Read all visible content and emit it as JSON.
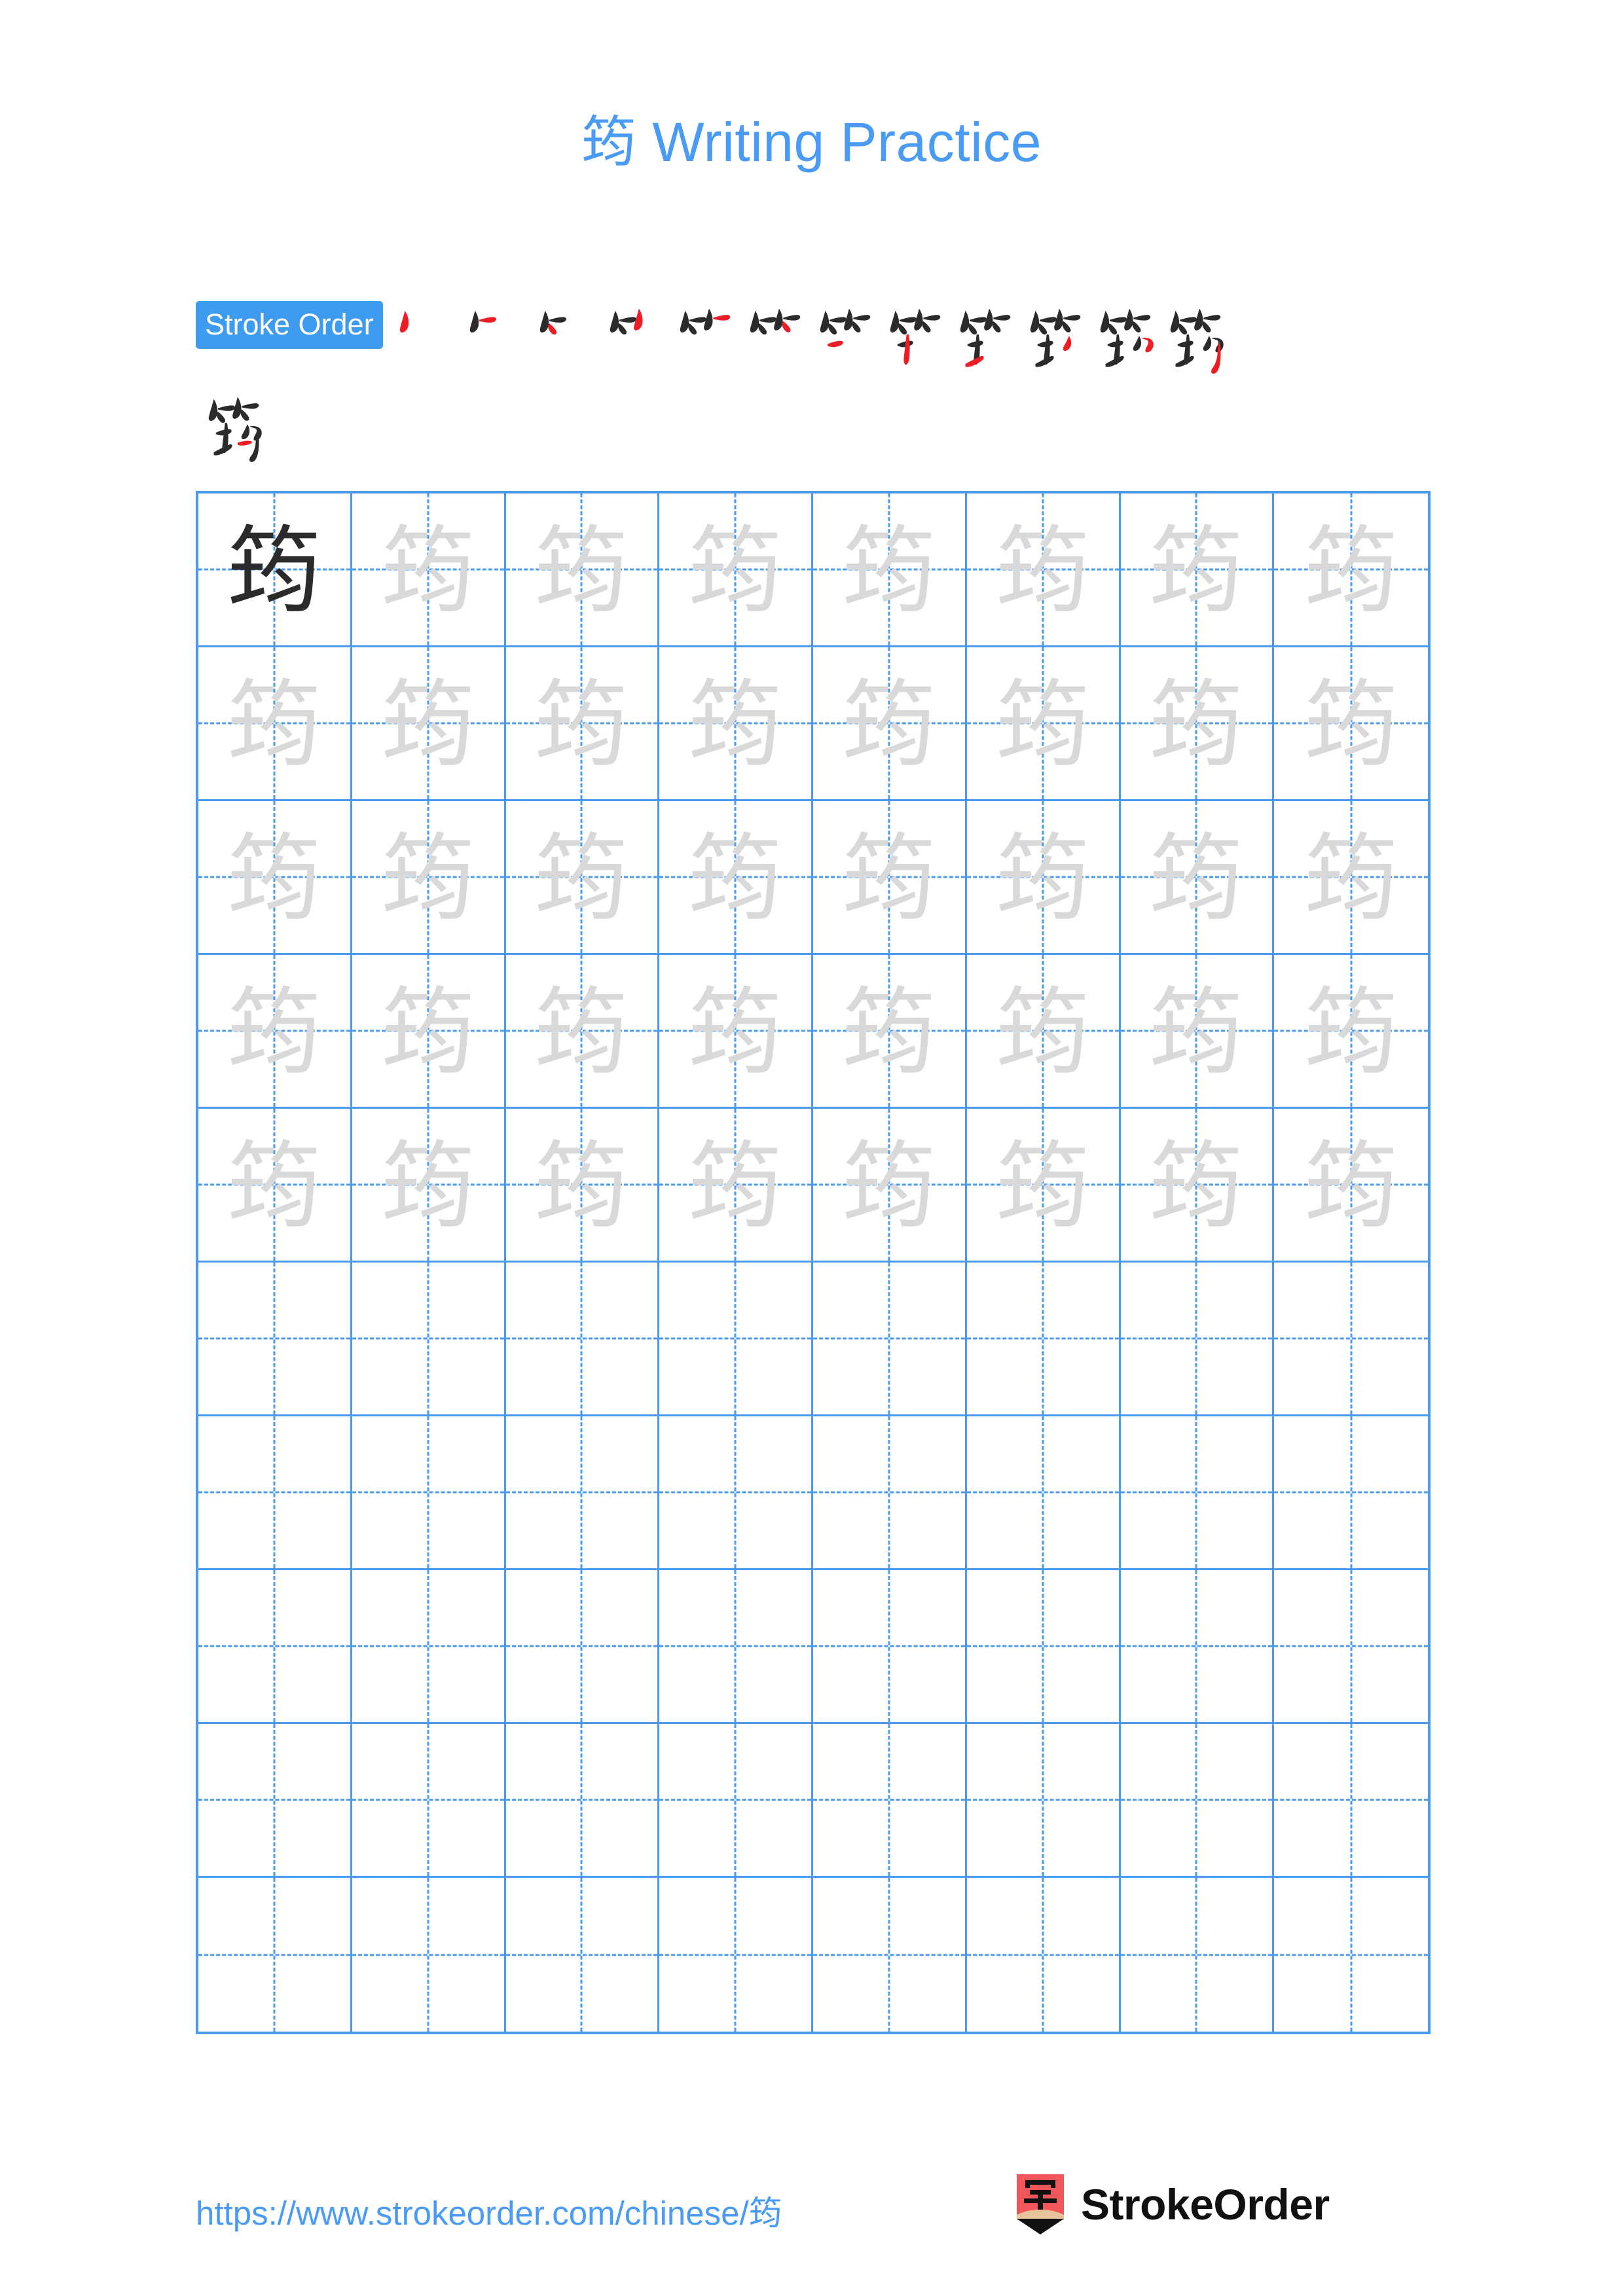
{
  "page": {
    "character": "筠",
    "title": "筠 Writing Practice",
    "background_color": "#ffffff",
    "accent_color": "#4a9bf5",
    "grid_line_color": "#4a9bf0",
    "trace_character_color": "#d9d9d9",
    "model_character_color": "#2b2b2b",
    "new_stroke_color": "#ee1c25",
    "existing_stroke_color": "#2b2b2b"
  },
  "stroke_order": {
    "badge_label": "Stroke Order",
    "total_strokes": 13,
    "row1_count": 12,
    "row2_count": 1,
    "steps": [
      {
        "index": 1,
        "strokes_shown": 1
      },
      {
        "index": 2,
        "strokes_shown": 2
      },
      {
        "index": 3,
        "strokes_shown": 3
      },
      {
        "index": 4,
        "strokes_shown": 4
      },
      {
        "index": 5,
        "strokes_shown": 5
      },
      {
        "index": 6,
        "strokes_shown": 6
      },
      {
        "index": 7,
        "strokes_shown": 7
      },
      {
        "index": 8,
        "strokes_shown": 8
      },
      {
        "index": 9,
        "strokes_shown": 9
      },
      {
        "index": 10,
        "strokes_shown": 10
      },
      {
        "index": 11,
        "strokes_shown": 11
      },
      {
        "index": 12,
        "strokes_shown": 12
      },
      {
        "index": 13,
        "strokes_shown": 13
      }
    ]
  },
  "practice_grid": {
    "columns": 8,
    "rows": 10,
    "filled_rows": 5,
    "empty_rows": 5,
    "first_cell_style": "model",
    "trace_cell_style": "trace"
  },
  "footer": {
    "url": "https://www.strokeorder.com/chinese/筠",
    "brand_name": "StrokeOrder",
    "logo_character": "字",
    "logo_color": "#f1565b",
    "logo_tip_color": "#e8c49a"
  }
}
